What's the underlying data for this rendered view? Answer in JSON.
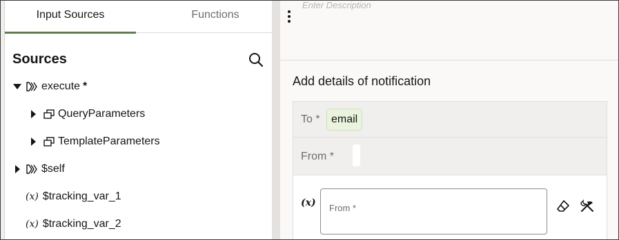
{
  "tabs": {
    "input_sources": "Input Sources",
    "functions": "Functions"
  },
  "sources": {
    "title": "Sources",
    "tree": [
      {
        "label": "execute",
        "suffix": "*"
      },
      {
        "label": "QueryParameters"
      },
      {
        "label": "TemplateParameters"
      },
      {
        "label": "$self"
      },
      {
        "label": "$tracking_var_1",
        "prefix": "(x)"
      },
      {
        "label": "$tracking_var_2",
        "prefix": "(x)"
      }
    ]
  },
  "editor": {
    "description_placeholder": "Enter Description",
    "section_title": "Add details of notification",
    "to_label": "To *",
    "to_value": "email",
    "from_label": "From *",
    "expression_icon": "(x)",
    "from_input_placeholder": "From *"
  },
  "colors": {
    "tab_underline": "#5f7d4f",
    "chip_background": "#e9f3dd"
  },
  "icons": [
    "search-icon",
    "kebab-menu-icon",
    "eraser-icon",
    "tools-icon",
    "collection-icon",
    "variable-icon"
  ]
}
